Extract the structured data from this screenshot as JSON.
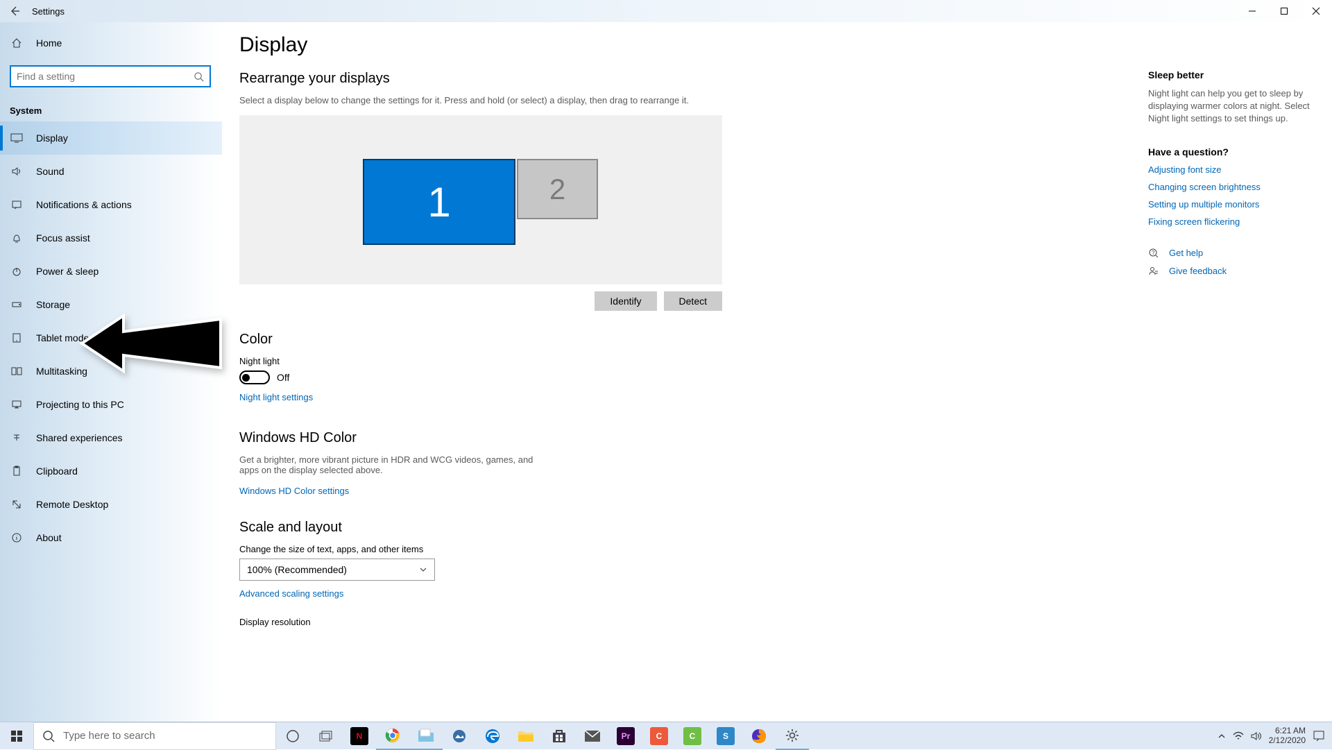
{
  "window": {
    "title": "Settings"
  },
  "sidebar": {
    "home": "Home",
    "search_placeholder": "Find a setting",
    "section": "System",
    "items": [
      {
        "label": "Display"
      },
      {
        "label": "Sound"
      },
      {
        "label": "Notifications & actions"
      },
      {
        "label": "Focus assist"
      },
      {
        "label": "Power & sleep"
      },
      {
        "label": "Storage"
      },
      {
        "label": "Tablet mode"
      },
      {
        "label": "Multitasking"
      },
      {
        "label": "Projecting to this PC"
      },
      {
        "label": "Shared experiences"
      },
      {
        "label": "Clipboard"
      },
      {
        "label": "Remote Desktop"
      },
      {
        "label": "About"
      }
    ]
  },
  "main": {
    "title": "Display",
    "rearrange_title": "Rearrange your displays",
    "rearrange_desc": "Select a display below to change the settings for it. Press and hold (or select) a display, then drag to rearrange it.",
    "monitor1": "1",
    "monitor2": "2",
    "identify_btn": "Identify",
    "detect_btn": "Detect",
    "color_title": "Color",
    "night_light_label": "Night light",
    "night_light_state": "Off",
    "night_light_link": "Night light settings",
    "hd_title": "Windows HD Color",
    "hd_desc": "Get a brighter, more vibrant picture in HDR and WCG videos, games, and apps on the display selected above.",
    "hd_link": "Windows HD Color settings",
    "scale_title": "Scale and layout",
    "scale_label": "Change the size of text, apps, and other items",
    "scale_value": "100% (Recommended)",
    "scale_link": "Advanced scaling settings",
    "resolution_label": "Display resolution"
  },
  "right": {
    "sleep_title": "Sleep better",
    "sleep_text": "Night light can help you get to sleep by displaying warmer colors at night. Select Night light settings to set things up.",
    "question_title": "Have a question?",
    "links": [
      "Adjusting font size",
      "Changing screen brightness",
      "Setting up multiple monitors",
      "Fixing screen flickering"
    ],
    "get_help": "Get help",
    "feedback": "Give feedback"
  },
  "taskbar": {
    "search_placeholder": "Type here to search",
    "time": "6:21 AM",
    "date": "2/12/2020"
  }
}
